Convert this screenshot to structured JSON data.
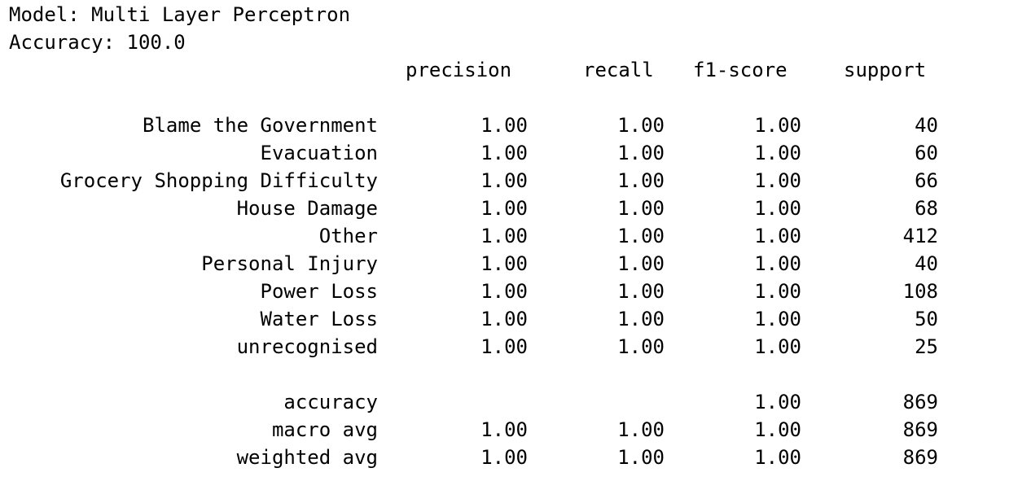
{
  "model_line": "Model: Multi Layer Perceptron",
  "accuracy_line": "Accuracy: 100.0",
  "columns": [
    "precision",
    "recall",
    "f1-score",
    "support"
  ],
  "rows": [
    {
      "label": "Blame the Government",
      "precision": "1.00",
      "recall": "1.00",
      "f1": "1.00",
      "support": "40"
    },
    {
      "label": "Evacuation",
      "precision": "1.00",
      "recall": "1.00",
      "f1": "1.00",
      "support": "60"
    },
    {
      "label": "Grocery Shopping Difficulty",
      "precision": "1.00",
      "recall": "1.00",
      "f1": "1.00",
      "support": "66"
    },
    {
      "label": "House Damage",
      "precision": "1.00",
      "recall": "1.00",
      "f1": "1.00",
      "support": "68"
    },
    {
      "label": "Other",
      "precision": "1.00",
      "recall": "1.00",
      "f1": "1.00",
      "support": "412"
    },
    {
      "label": "Personal Injury",
      "precision": "1.00",
      "recall": "1.00",
      "f1": "1.00",
      "support": "40"
    },
    {
      "label": "Power Loss",
      "precision": "1.00",
      "recall": "1.00",
      "f1": "1.00",
      "support": "108"
    },
    {
      "label": "Water Loss",
      "precision": "1.00",
      "recall": "1.00",
      "f1": "1.00",
      "support": "50"
    },
    {
      "label": "unrecognised",
      "precision": "1.00",
      "recall": "1.00",
      "f1": "1.00",
      "support": "25"
    }
  ],
  "summary": [
    {
      "label": "accuracy",
      "precision": "",
      "recall": "",
      "f1": "1.00",
      "support": "869"
    },
    {
      "label": "macro avg",
      "precision": "1.00",
      "recall": "1.00",
      "f1": "1.00",
      "support": "869"
    },
    {
      "label": "weighted avg",
      "precision": "1.00",
      "recall": "1.00",
      "f1": "1.00",
      "support": "869"
    }
  ]
}
